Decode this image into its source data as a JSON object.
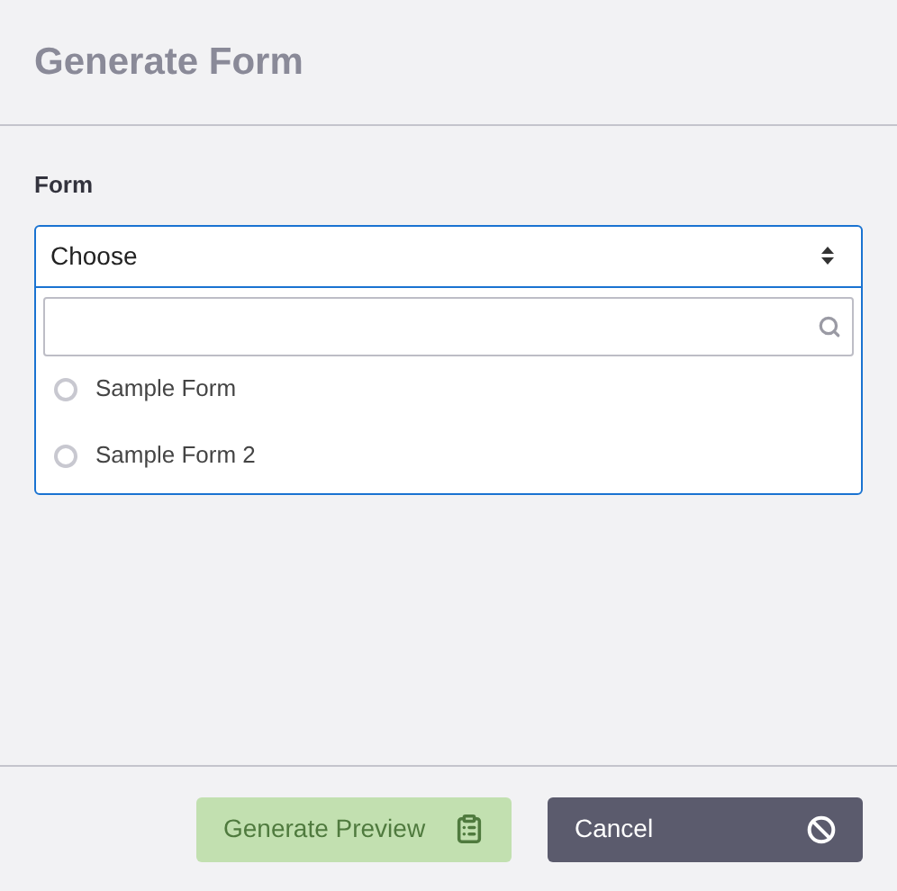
{
  "dialog": {
    "title": "Generate Form"
  },
  "form_field": {
    "label": "Form",
    "value": "Choose",
    "expanded": true,
    "options": [
      {
        "label": "Sample Form",
        "selected": false
      },
      {
        "label": "Sample Form 2",
        "selected": false
      }
    ]
  },
  "buttons": [
    {
      "label": "Generate Preview",
      "kind": "generate",
      "disabled": true
    },
    {
      "label": "Cancel",
      "kind": "cancel",
      "disabled": false
    }
  ]
}
